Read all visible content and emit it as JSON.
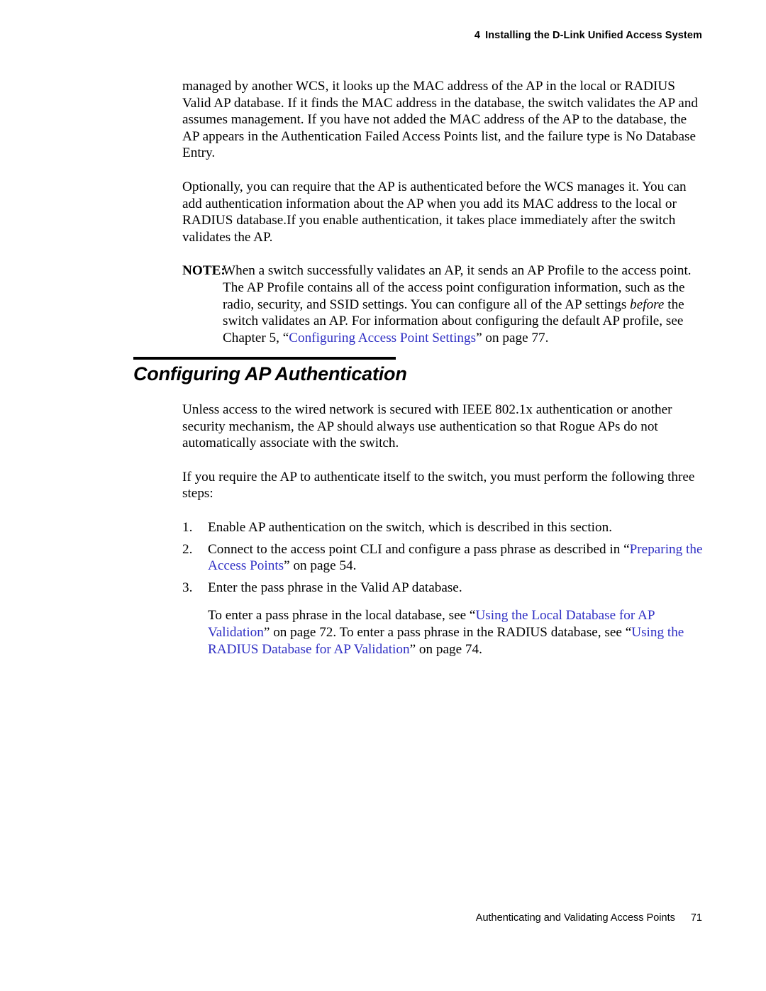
{
  "header": {
    "chapter_number": "4",
    "title": "Installing the D-Link Unified Access System"
  },
  "footer": {
    "title": "Authenticating and Validating Access Points",
    "page_number": "71"
  },
  "colors": {
    "link": "#2f2fc4",
    "text": "#000000",
    "background": "#ffffff"
  },
  "body": {
    "paragraph_1": "managed by another WCS, it looks up the MAC address of the AP in the local or RADIUS Valid AP database. If it finds the MAC address in the database, the switch validates the AP and assumes management. If you have not added the MAC address of the AP to the database, the AP appears in the Authentication Failed Access Points list, and the failure type is No Database Entry.",
    "paragraph_2": "Optionally, you can require that the AP is authenticated before the WCS manages it. You can add authentication information about the AP when you add its MAC address to the local or RADIUS database.If you enable authentication, it takes place immediately after the switch validates the AP."
  },
  "note": {
    "label": "NOTE:",
    "text_part_1": "When a switch successfully validates an AP, it sends an AP Profile to the access point. The AP Profile contains all of the access point configuration information, such as the radio, security, and SSID settings. You can configure all of the AP settings ",
    "emphasis": "before",
    "text_part_2": " the switch validates an AP. For information about configuring the default AP profile, see Chapter 5, “",
    "link": "Configuring Access Point Settings",
    "text_part_3": "” on page 77."
  },
  "section": {
    "title": "Configuring AP Authentication",
    "paragraph_1": "Unless access to the wired network is secured with IEEE 802.1x authentication or another security mechanism, the AP should always use authentication so that Rogue APs do not automatically associate with the switch.",
    "paragraph_2": "If you require the AP to authenticate itself to the switch, you must perform the following three steps:"
  },
  "steps": [
    {
      "number": "1.",
      "text_part_1": "Enable AP authentication on the switch, which is described in this section.",
      "link": "",
      "text_part_2": ""
    },
    {
      "number": "2.",
      "text_part_1": "Connect to the access point CLI and configure a pass phrase as described in “",
      "link": "Preparing the Access Points",
      "text_part_2": "” on page 54."
    },
    {
      "number": "3.",
      "text_part_1": "Enter the pass phrase in the Valid AP database.",
      "link": "",
      "text_part_2": ""
    }
  ],
  "closing_paragraph": {
    "text_part_1": "To enter a pass phrase in the local database, see “",
    "link_1": "Using the Local Database for AP Validation",
    "text_part_2": "” on page 72. To enter a pass phrase in the RADIUS database, see “",
    "link_2": "Using the RADIUS Database for AP Validation",
    "text_part_3": "” on page 74."
  }
}
